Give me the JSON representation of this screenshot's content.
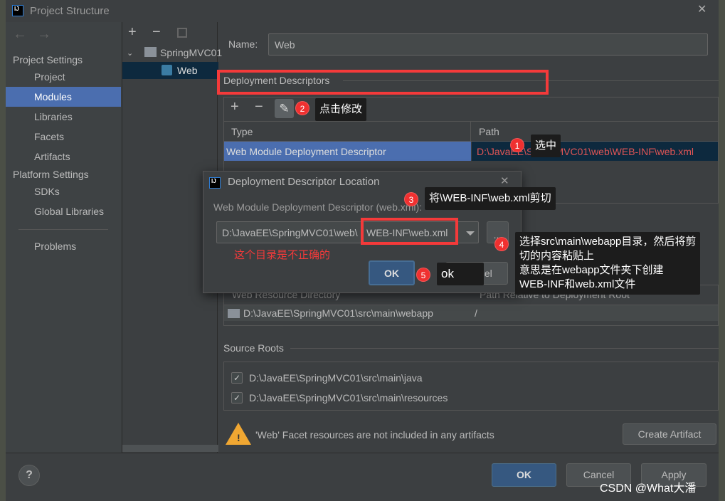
{
  "window": {
    "title": "Project Structure",
    "close": "✕"
  },
  "nav": {
    "back": "←",
    "forward": "→"
  },
  "sidebar": {
    "section1": "Project Settings",
    "items1": [
      "Project",
      "Modules",
      "Libraries",
      "Facets",
      "Artifacts"
    ],
    "section2": "Platform Settings",
    "items2": [
      "SDKs",
      "Global Libraries"
    ],
    "problems": "Problems"
  },
  "tree": {
    "toolbar": [
      "+",
      "−"
    ],
    "root": "SpringMVC01",
    "child": "Web"
  },
  "main": {
    "name_label": "Name:",
    "name_value": "Web",
    "dd_header": "Deployment Descriptors",
    "dd_toolbar": [
      "+",
      "−",
      "✎"
    ],
    "dd_columns": [
      "Type",
      "Path"
    ],
    "dd_row": {
      "type": "Web Module Deployment Descriptor",
      "path": "D:\\JavaEE\\SpringMVC01\\web\\WEB-INF\\web.xml"
    },
    "wr_columns": [
      "Web Resource Directory",
      "Path Relative to Deployment Root"
    ],
    "wr_row": {
      "dir": "D:\\JavaEE\\SpringMVC01\\src\\main\\webapp",
      "path": "/"
    },
    "source_roots_header": "Source Roots",
    "source_roots": [
      "D:\\JavaEE\\SpringMVC01\\src\\main\\java",
      "D:\\JavaEE\\SpringMVC01\\src\\main\\resources"
    ],
    "warning": "'Web' Facet resources are not included in any artifacts",
    "create_artifact": "Create Artifact"
  },
  "footer": {
    "help": "?",
    "ok": "OK",
    "cancel": "Cancel",
    "apply": "Apply"
  },
  "dialog": {
    "title": "Deployment Descriptor Location",
    "close": "✕",
    "label": "Web Module Deployment Descriptor (web.xml):",
    "value_prefix": "D:\\JavaEE\\SpringMVC01\\web\\",
    "value_highlight": "WEB-INF\\web.xml",
    "browse": "...",
    "ok": "OK",
    "cancel": "Cancel"
  },
  "annotations": {
    "wrong_dir": "这个目录是不正确的",
    "badges": [
      "1",
      "2",
      "3",
      "4",
      "5"
    ],
    "tip1": "选中",
    "tip2": "点击修改",
    "tip3": "将\\WEB-INF\\web.xml剪切",
    "tip4": [
      "选择src\\main\\webapp目录，然后将剪",
      "切的内容粘贴上",
      "意思是在webapp文件夹下创建",
      "WEB-INF和web.xml文件"
    ],
    "tip5": "ok"
  },
  "watermark": "CSDN @What大潘",
  "colors": {
    "background": "#3c3f41",
    "selection": "#4b6eaf",
    "annotation_red": "#f43a3a",
    "path_red": "#e05555"
  }
}
